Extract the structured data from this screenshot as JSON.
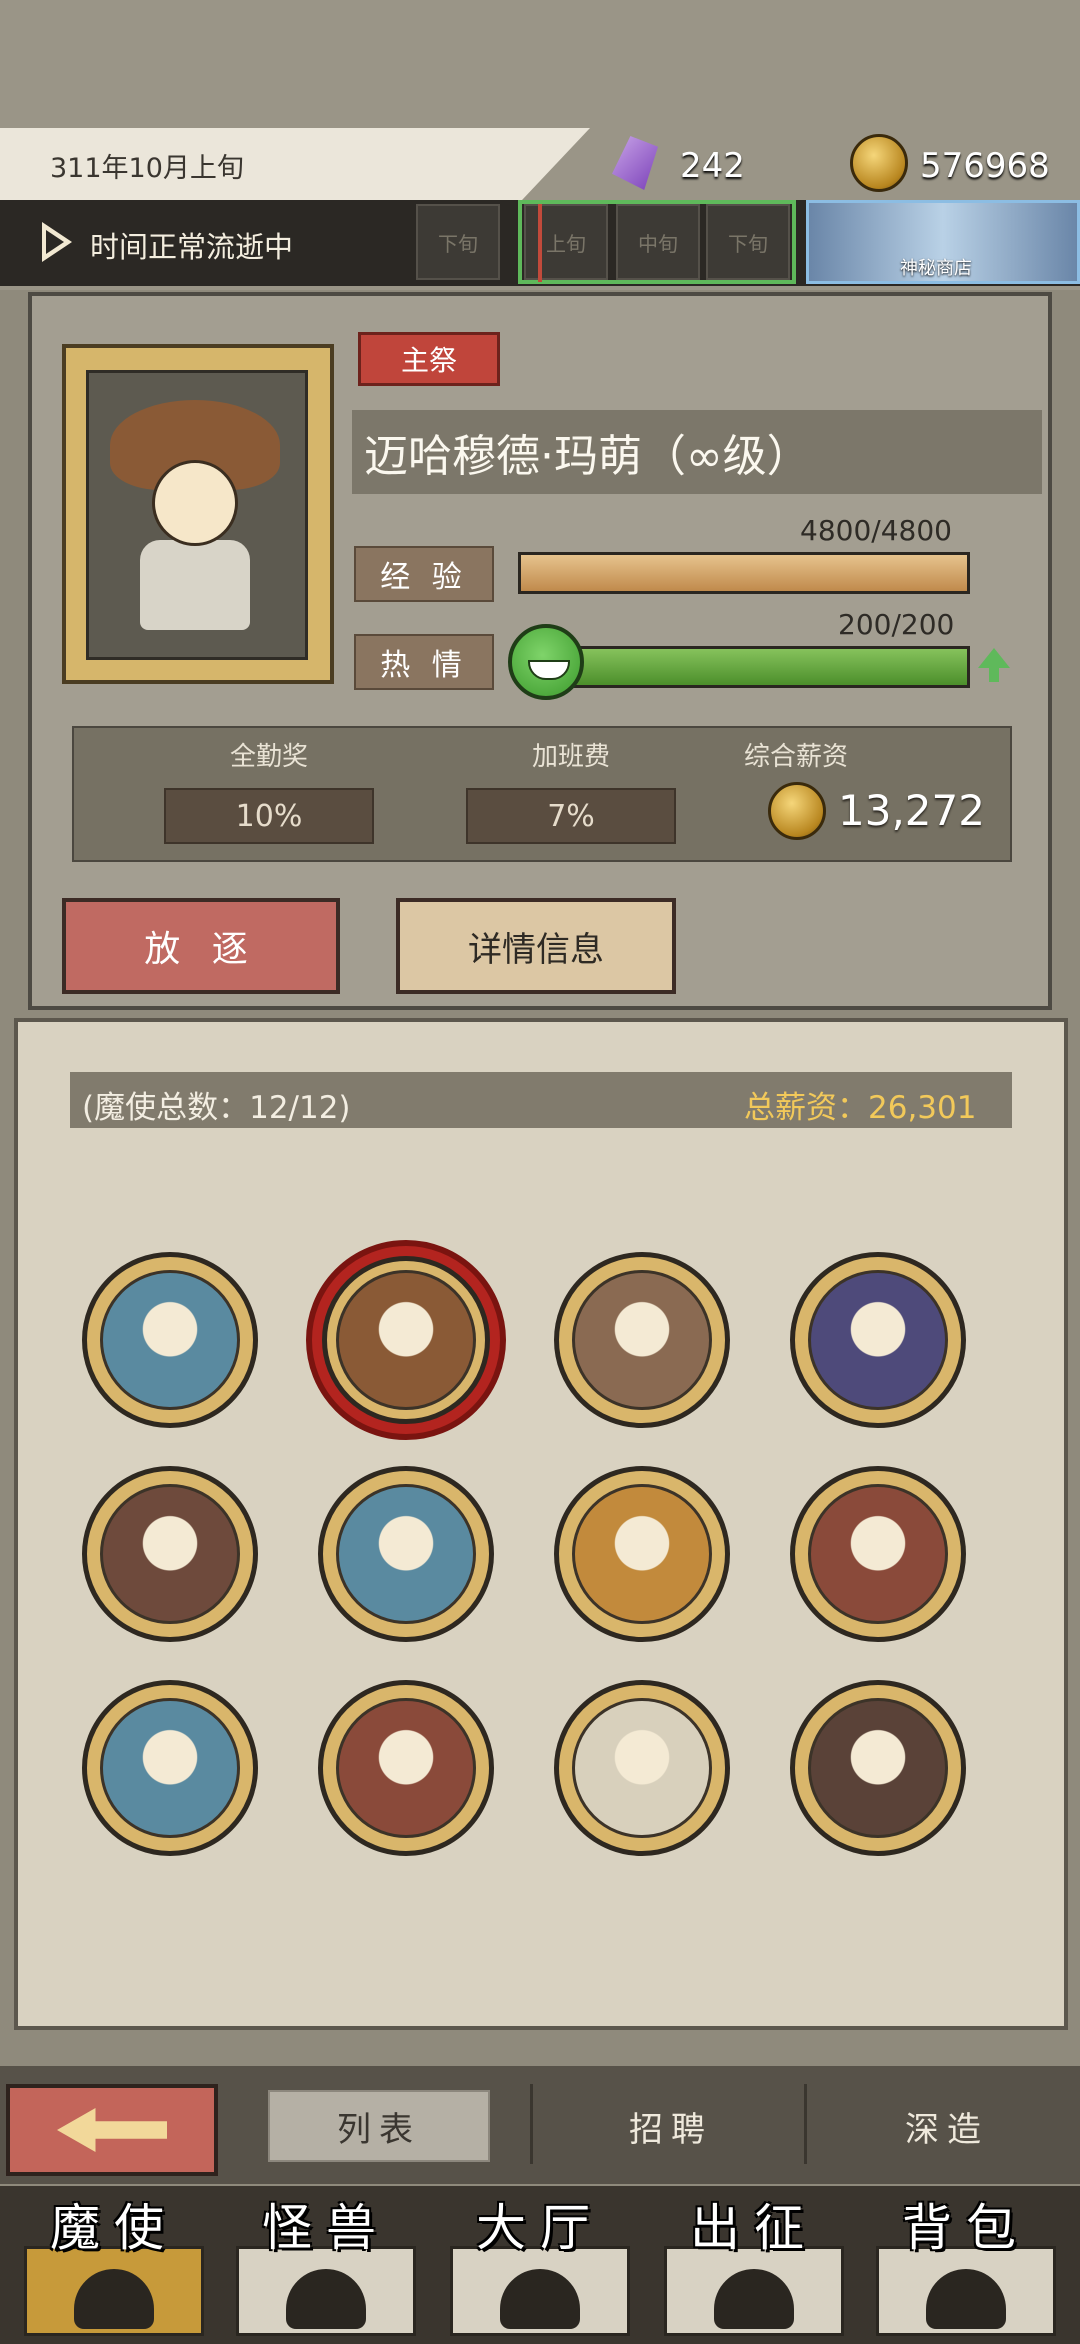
{
  "header": {
    "date": "311年10月上旬",
    "gems": "242",
    "gold": "576968",
    "time_status": "时间正常流逝中",
    "periods": [
      "下旬",
      "上旬",
      "中旬",
      "下旬"
    ],
    "shop_label": "神秘商店"
  },
  "profile": {
    "role_badge": "主祭",
    "name": "迈哈穆德·玛萌（∞级）",
    "exp_label": "经 验",
    "exp_value": "4800/4800",
    "exp_fraction": 1.0,
    "passion_label": "热 情",
    "passion_value": "200/200",
    "passion_fraction": 1.0,
    "bonus": [
      {
        "title": "全勤奖",
        "value": "10%"
      },
      {
        "title": "加班费",
        "value": "7%"
      }
    ],
    "total_salary_title": "综合薪资",
    "total_salary_value": "13,272",
    "exile_button": "放 逐",
    "detail_button": "详情信息"
  },
  "roster": {
    "count_text": "(魔使总数：12/12)",
    "salary_text": "总薪资：26,301",
    "selected_index": 1,
    "avatars": [
      {
        "name": "hooded-blue-cat",
        "color": "#5a8aa0"
      },
      {
        "name": "witch-blonde",
        "color": "#8a5a36"
      },
      {
        "name": "maned-red-eye",
        "color": "#8a6a52"
      },
      {
        "name": "purple-hat-lilac",
        "color": "#4e4a7a"
      },
      {
        "name": "brown-hair-dark",
        "color": "#6e4a3c"
      },
      {
        "name": "hooded-blue-cat-2",
        "color": "#5a8aa0"
      },
      {
        "name": "pumpkin-hat-lilac",
        "color": "#c28a3c"
      },
      {
        "name": "masked-barbarian",
        "color": "#8a4a3a"
      },
      {
        "name": "hooded-blue-cat-3",
        "color": "#5a8aa0"
      },
      {
        "name": "masked-barbarian-2",
        "color": "#8a4a3a"
      },
      {
        "name": "white-lion",
        "color": "#d8d0bc"
      },
      {
        "name": "horned-warrior",
        "color": "#5a4238"
      }
    ]
  },
  "subnav": {
    "tabs": [
      "列表",
      "招聘",
      "深造"
    ],
    "active": 0
  },
  "main_nav": {
    "items": [
      "魔使",
      "怪兽",
      "大厅",
      "出征",
      "背包"
    ],
    "active": 0
  },
  "colors": {
    "accent_green": "#5fb95b",
    "accent_red": "#c0453b",
    "gold_text": "#f2c95a"
  }
}
